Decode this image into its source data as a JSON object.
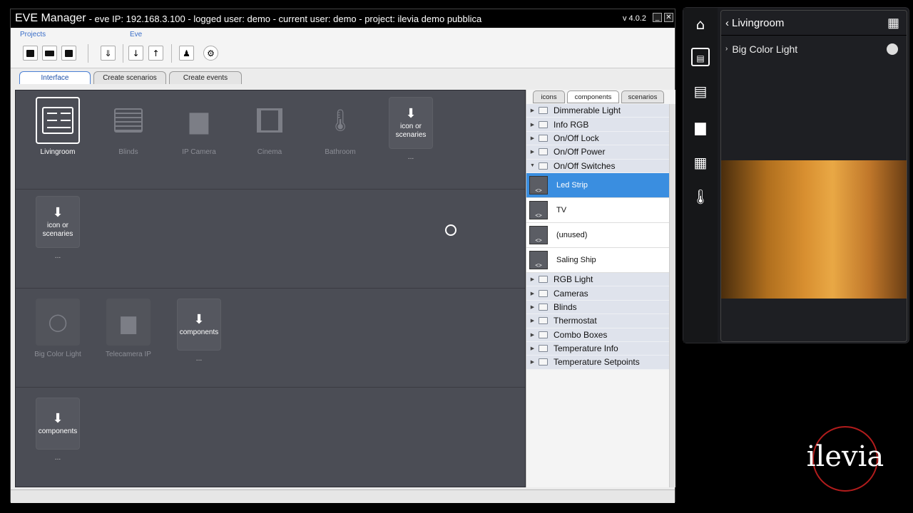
{
  "window": {
    "title_app": "EVE Manager",
    "title_rest": " - eve IP: 192.168.3.100 - logged user: demo - current user: demo - project: ilevia demo pubblica",
    "version": "v 4.0.2"
  },
  "toolbar": {
    "projects_label": "Projects",
    "eve_label": "Eve"
  },
  "tabs": [
    "Interface",
    "Create scenarios",
    "Create events"
  ],
  "rooms": [
    {
      "label": "Livingroom",
      "icon": "livingroom-icon"
    },
    {
      "label": "Blinds",
      "icon": "blinds-icon"
    },
    {
      "label": "IP Camera",
      "icon": "camera-icon"
    },
    {
      "label": "Cinema",
      "icon": "film-icon"
    },
    {
      "label": "Bathroom",
      "icon": "thermometer-icon"
    }
  ],
  "drop_icon_text": "icon or scenaries",
  "drop_components_text": "components",
  "dots": "...",
  "components_row": [
    {
      "label": "Big Color Light"
    },
    {
      "label": "Telecamera IP"
    }
  ],
  "panel_tabs": [
    "icons",
    "components",
    "scenarios"
  ],
  "tree_top": [
    "Dimmerable Light",
    "Info RGB",
    "On/Off Lock",
    "On/Off Power",
    "On/Off Switches"
  ],
  "tree_items": [
    "Led Strip",
    "TV",
    "(unused)",
    "Saling Ship"
  ],
  "tree_bottom": [
    "RGB Light",
    "Cameras",
    "Blinds",
    "Thermostat",
    "Combo Boxes",
    "Temperature Info",
    "Temperature Setpoints"
  ],
  "phone": {
    "title": "Livingroom",
    "row_label": "Big Color Light"
  },
  "logo": "ilevia"
}
